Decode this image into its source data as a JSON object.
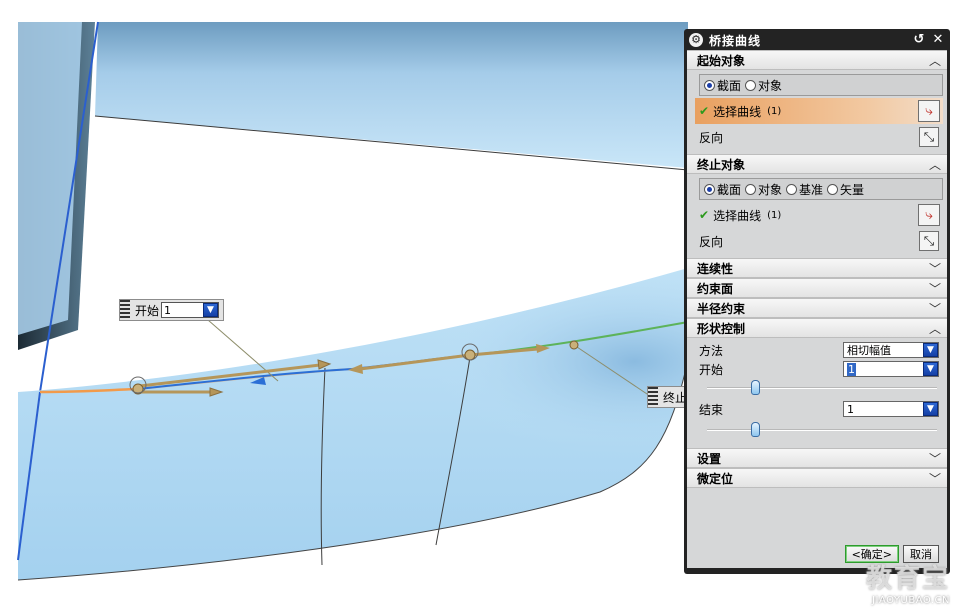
{
  "canvas": {
    "float_start": {
      "label": "开始",
      "value": "1"
    },
    "float_end": {
      "label": "终止"
    }
  },
  "dialog": {
    "title": "桥接曲线",
    "start_object": {
      "header": "起始对象",
      "radios": [
        {
          "label": "截面",
          "selected": true
        },
        {
          "label": "对象",
          "selected": false
        }
      ],
      "select_curve_label": "选择曲线",
      "select_curve_count": "(1)",
      "reverse_label": "反向"
    },
    "end_object": {
      "header": "终止对象",
      "radios": [
        {
          "label": "截面",
          "selected": true
        },
        {
          "label": "对象",
          "selected": false
        },
        {
          "label": "基准",
          "selected": false
        },
        {
          "label": "矢量",
          "selected": false
        }
      ],
      "select_curve_label": "选择曲线",
      "select_curve_count": "(1)",
      "reverse_label": "反向"
    },
    "collapsed_sections": [
      "连续性",
      "约束面",
      "半径约束"
    ],
    "shape_control": {
      "header": "形状控制",
      "method_label": "方法",
      "method_value": "相切幅值",
      "start_label": "开始",
      "start_value": "1",
      "start_slider_fraction": 0.2,
      "end_label": "结束",
      "end_value": "1",
      "end_slider_fraction": 0.2
    },
    "bottom_sections": [
      "设置",
      "微定位"
    ],
    "ok_label": "<确定>",
    "cancel_label": "取消"
  },
  "watermark": {
    "main": "教育宝",
    "sub": "JIAOYUBAO.CN"
  },
  "colors": {
    "surface_light": "#c5e4f7",
    "surface_mid": "#a9d3ef",
    "curve_orange": "#f29a4a",
    "curve_blue": "#2b6fd6",
    "curve_green": "#5db35a",
    "arrow_tan": "#b5965a",
    "dialog_frame": "#232323",
    "dialog_body": "#d6d7d8"
  }
}
